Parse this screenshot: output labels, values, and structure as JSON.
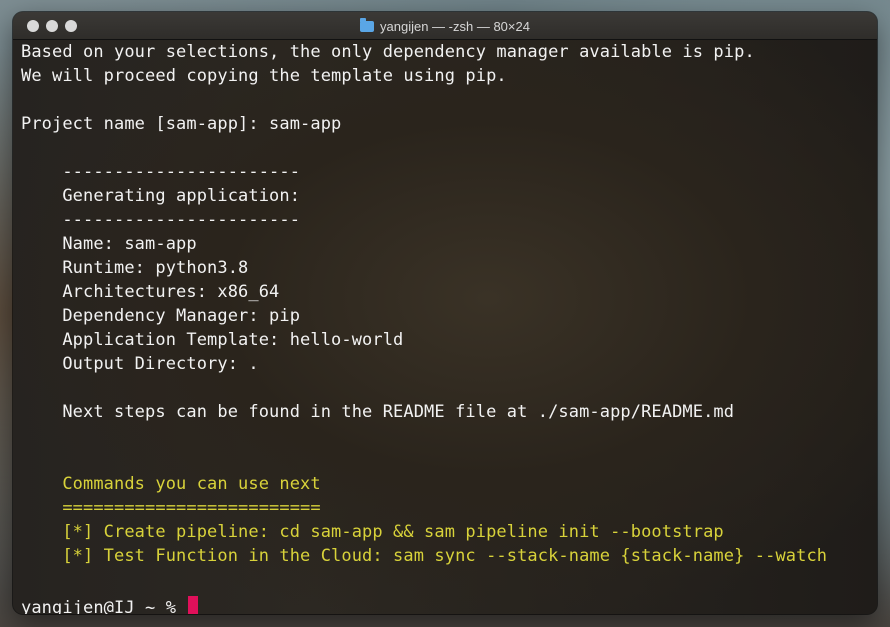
{
  "window": {
    "title": "yangijen — -zsh — 80×24"
  },
  "terminal": {
    "lines": [
      "Based on your selections, the only dependency manager available is pip.",
      "We will proceed copying the template using pip.",
      "",
      "Project name [sam-app]: sam-app",
      "",
      "    -----------------------",
      "    Generating application:",
      "    -----------------------",
      "    Name: sam-app",
      "    Runtime: python3.8",
      "    Architectures: x86_64",
      "    Dependency Manager: pip",
      "    Application Template: hello-world",
      "    Output Directory: .",
      "",
      "    Next steps can be found in the README file at ./sam-app/README.md",
      "",
      "",
      "    Commands you can use next",
      "    =========================",
      "    [*] Create pipeline: cd sam-app && sam pipeline init --bootstrap",
      "    [*] Test Function in the Cloud: sam sync --stack-name {stack-name} --watch",
      "",
      "yangijen@IJ ~ % "
    ],
    "colors": {
      "text": "#f2f2f2",
      "highlight": "#d8d23a",
      "cursor": "#e0105a"
    }
  }
}
